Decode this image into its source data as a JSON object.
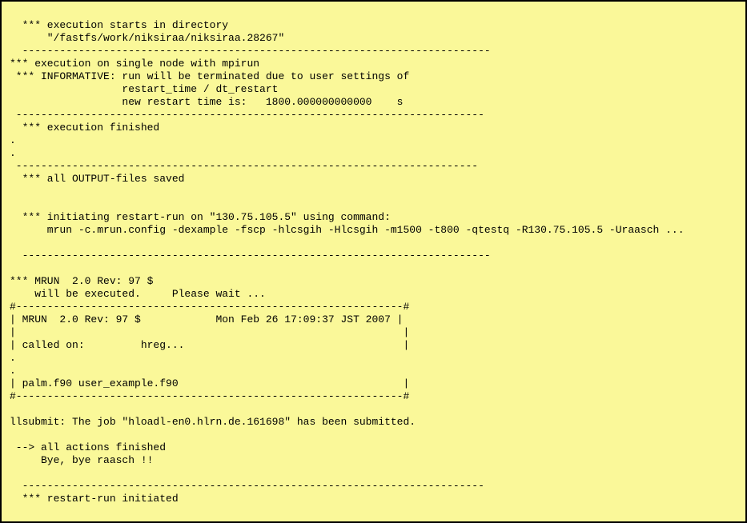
{
  "terminal": {
    "lines": [
      "  *** execution starts in directory",
      "      \"/fastfs/work/niksiraa/niksiraa.28267\"",
      "  ---------------------------------------------------------------------------",
      "*** execution on single node with mpirun",
      " *** INFORMATIVE: run will be terminated due to user settings of",
      "                  restart_time / dt_restart",
      "                  new restart time is:   1800.000000000000    s",
      " ---------------------------------------------------------------------------",
      "  *** execution finished",
      ".",
      ".",
      " --------------------------------------------------------------------------",
      "  *** all OUTPUT-files saved",
      "",
      "",
      "  *** initiating restart-run on \"130.75.105.5\" using command:",
      "      mrun -c.mrun.config -dexample -fscp -hlcsgih -Hlcsgih -m1500 -t800 -qtestq -R130.75.105.5 -Uraasch ...",
      "",
      "  ---------------------------------------------------------------------------",
      "",
      "*** MRUN  2.0 Rev: 97 $",
      "    will be executed.     Please wait ...",
      "#--------------------------------------------------------------#",
      "| MRUN  2.0 Rev: 97 $            Mon Feb 26 17:09:37 JST 2007 |",
      "|                                                              |",
      "| called on:         hreg...                                   |",
      ".",
      ".",
      "| palm.f90 user_example.f90                                    |",
      "#--------------------------------------------------------------#",
      "",
      "llsubmit: The job \"hloadl-en0.hlrn.de.161698\" has been submitted.",
      "",
      " --> all actions finished",
      "     Bye, bye raasch !!",
      "",
      "  --------------------------------------------------------------------------",
      "  *** restart-run initiated"
    ]
  }
}
